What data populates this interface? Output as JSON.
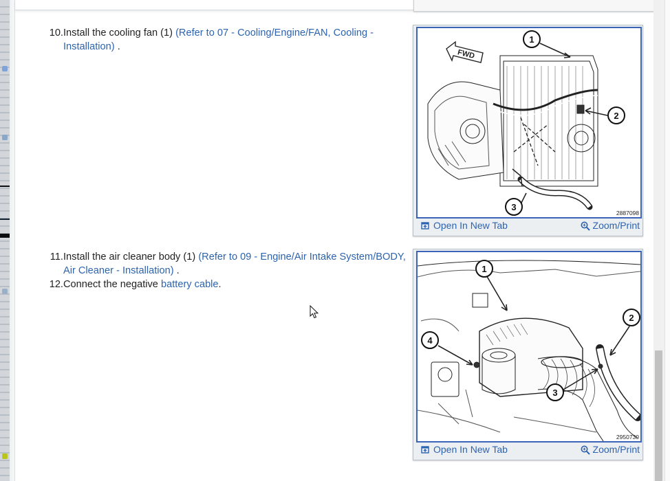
{
  "steps": [
    {
      "num": "10.",
      "text": "Install the cooling fan (1) ",
      "link": "(Refer to 07 - Cooling/Engine/FAN, Cooling - Installation)",
      "suffix": " ."
    },
    {
      "num": "11.",
      "text": "Install the air cleaner body (1) ",
      "link": "(Refer to 09 - Engine/Air Intake System/BODY, Air Cleaner - Installation)",
      "suffix": " ."
    },
    {
      "num": "12.",
      "text": "Connect the negative ",
      "link": "battery cable",
      "suffix": "."
    }
  ],
  "figures": [
    {
      "code": "2887098",
      "fwd_label": "FWD",
      "callouts": [
        "1",
        "2",
        "3"
      ],
      "open_label": "Open In New Tab",
      "zoom_label": "Zoom/Print"
    },
    {
      "code": "2950730",
      "callouts": [
        "1",
        "2",
        "3",
        "4"
      ],
      "open_label": "Open In New Tab",
      "zoom_label": "Zoom/Print"
    }
  ],
  "colors": {
    "link": "#2c63b0",
    "figure_border": "#3b63b8",
    "scroll_thumb": "#c1c1c1"
  },
  "icons": [
    "open-in-new-tab-icon",
    "zoom-icon",
    "mouse-cursor-icon"
  ]
}
